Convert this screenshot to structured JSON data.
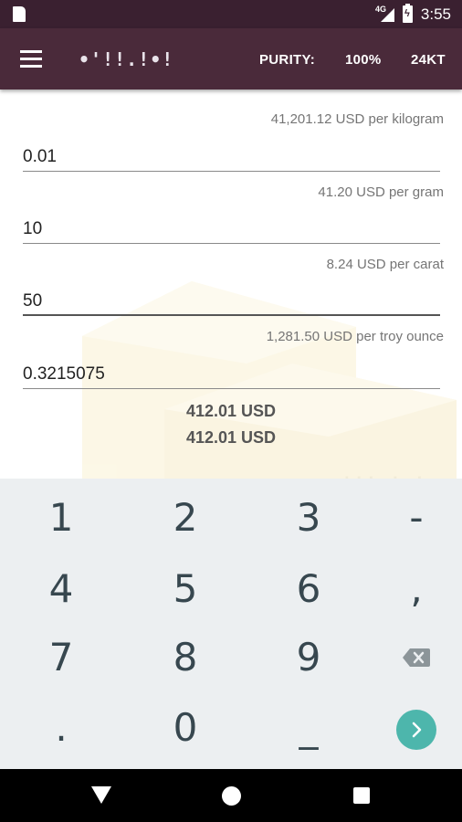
{
  "status_bar": {
    "network": "4G",
    "time": "3:55"
  },
  "toolbar": {
    "logo": "•'!!.!•!",
    "purity_label": "PURITY:",
    "purity_value": "100%",
    "karat": "24KT"
  },
  "converter": {
    "kilogram": {
      "rate": "41,201.12 USD per kilogram",
      "value": "0.01"
    },
    "gram": {
      "rate": "41.20 USD per gram",
      "value": "10"
    },
    "carat": {
      "rate": "8.24 USD per carat",
      "value": "50"
    },
    "troy_ounce": {
      "rate": "1,281.50 USD per troy ounce",
      "value": "0.3215075"
    }
  },
  "results": [
    "412.01 USD",
    "412.01 USD"
  ],
  "keypad": {
    "row1": [
      "1",
      "2",
      "3",
      "-"
    ],
    "row2": [
      "4",
      "5",
      "6",
      ","
    ],
    "row3": [
      "7",
      "8",
      "9"
    ],
    "row4": [
      ".",
      "0",
      "_"
    ],
    "backspace_icon": "backspace-icon",
    "next_icon": "chevron-right-icon",
    "accent_color": "#4db6ac"
  },
  "colors": {
    "toolbar": "#4a2a3a",
    "status_bar": "#3a2030",
    "keypad_bg": "#eceff1"
  }
}
